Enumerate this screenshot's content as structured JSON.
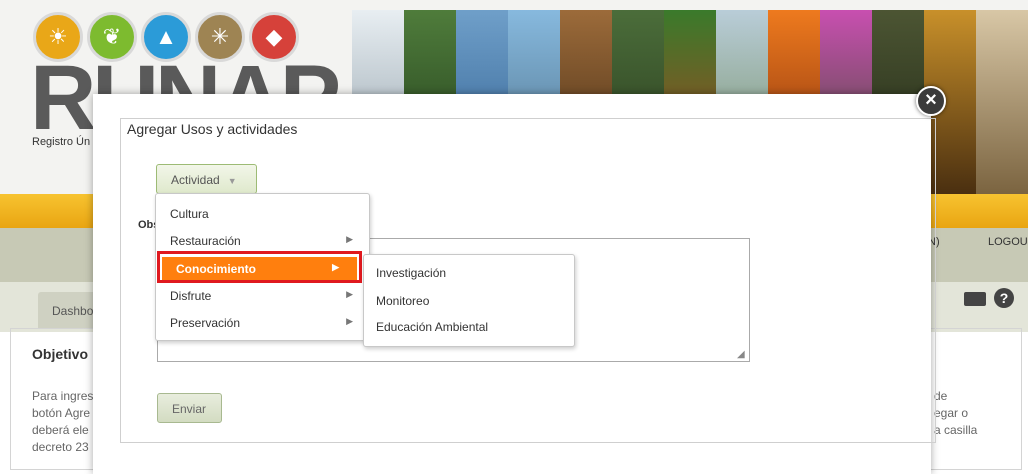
{
  "header": {
    "logo_text": "RUNAP",
    "logo_subtitle": "Registro Ún",
    "logo_icons": [
      "palm-tree-icon",
      "leaf-icon",
      "mountain-icon",
      "grass-icon",
      "bear-icon"
    ],
    "logo_colors": [
      "#e9a718",
      "#7dbb2f",
      "#2b9bd8",
      "#9e8453",
      "#d6413a"
    ]
  },
  "nav": {
    "login_partial": "N)",
    "logout": "LOGOUT"
  },
  "tabs": {
    "dashboard_partial": "Dashbo"
  },
  "objetivo": {
    "title": "Objetivo",
    "lines_left": [
      "Para ingres",
      "botón Agre",
      "deberá ele",
      "decreto 23"
    ],
    "lines_right": [
      "de",
      "egar o",
      "a casilla"
    ]
  },
  "modal": {
    "close_symbol": "×",
    "legend": "Agregar Usos y actividades",
    "actividad_button": "Actividad",
    "obs_label": "Obs",
    "submit_button": "Enviar",
    "menu": {
      "items": [
        {
          "label": "Cultura",
          "has_submenu": false
        },
        {
          "label": "Restauración",
          "has_submenu": true
        },
        {
          "label": "Conocimiento",
          "has_submenu": true,
          "active": true
        },
        {
          "label": "Disfrute",
          "has_submenu": true
        },
        {
          "label": "Preservación",
          "has_submenu": true
        }
      ],
      "submenu": [
        "Investigación",
        "Monitoreo",
        "Educación Ambiental"
      ],
      "active_color": "#ff7f0e",
      "highlight_color": "#e0191f"
    }
  }
}
